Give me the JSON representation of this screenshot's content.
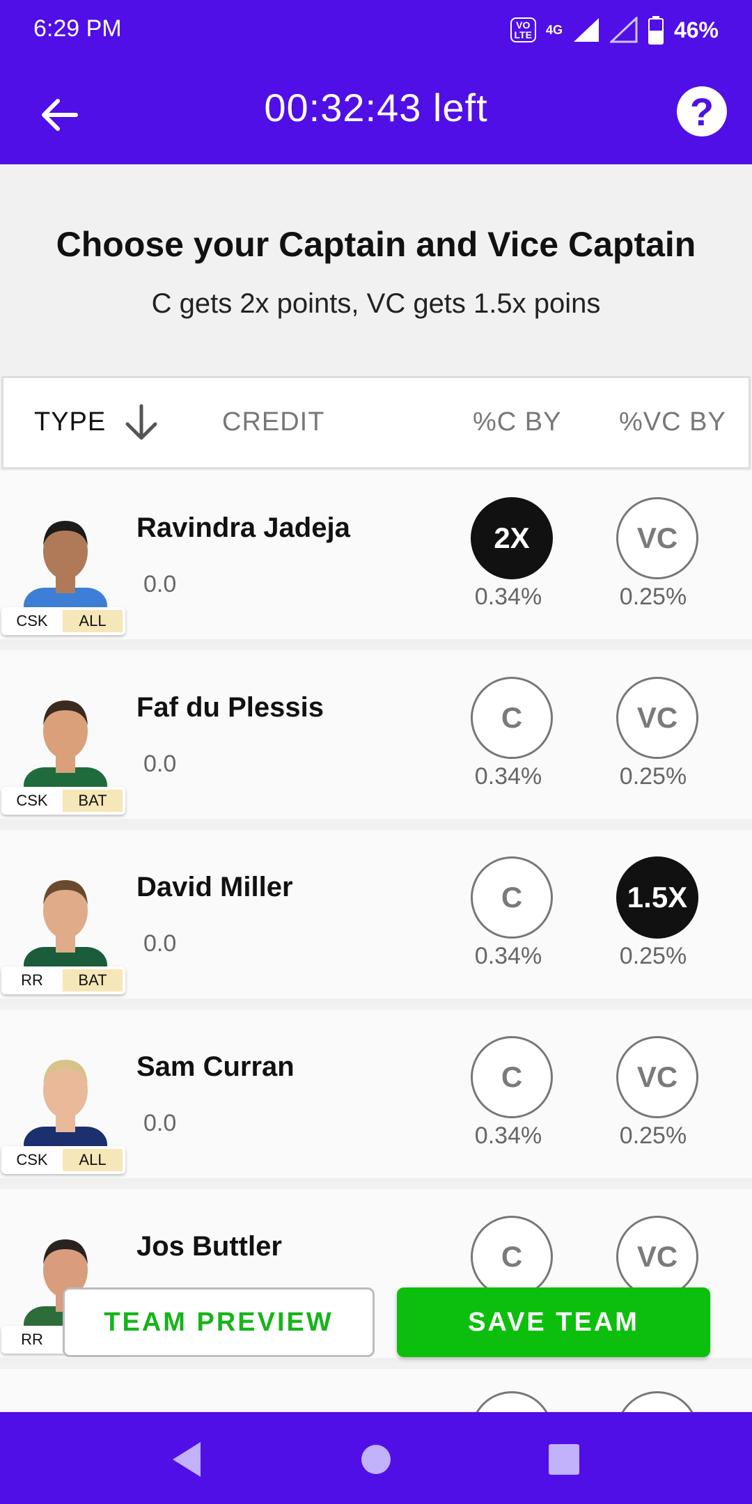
{
  "status_bar": {
    "time": "6:29 PM",
    "volte": "VoLTE",
    "network": "4G",
    "battery": "46%"
  },
  "toolbar": {
    "timer": "00:32:43 left",
    "help_label": "?"
  },
  "heading": {
    "title": "Choose your Captain and Vice Captain",
    "subtitle": "C gets 2x points, VC gets 1.5x poins"
  },
  "table_header": {
    "type": "TYPE",
    "credit": "CREDIT",
    "c_by": "%C BY",
    "vc_by": "%VC BY"
  },
  "players": [
    {
      "name": "Ravindra Jadeja",
      "credit": "0.0",
      "team": "CSK",
      "role": "ALL",
      "c_label": "2X",
      "c_active": true,
      "vc_label": "VC",
      "vc_active": false,
      "c_pct": "0.34%",
      "vc_pct": "0.25%",
      "jersey": "#3d7fd6",
      "skin": "#b07a58",
      "hair": "#1c1a1a"
    },
    {
      "name": "Faf du Plessis",
      "credit": "0.0",
      "team": "CSK",
      "role": "BAT",
      "c_label": "C",
      "c_active": false,
      "vc_label": "VC",
      "vc_active": false,
      "c_pct": "0.34%",
      "vc_pct": "0.25%",
      "jersey": "#1f6b3c",
      "skin": "#d9a07a",
      "hair": "#3a2a20"
    },
    {
      "name": "David Miller",
      "credit": "0.0",
      "team": "RR",
      "role": "BAT",
      "c_label": "C",
      "c_active": false,
      "vc_label": "1.5X",
      "vc_active": true,
      "c_pct": "0.34%",
      "vc_pct": "0.25%",
      "jersey": "#1b5c3a",
      "skin": "#e0ab88",
      "hair": "#6a4a2e"
    },
    {
      "name": "Sam Curran",
      "credit": "0.0",
      "team": "CSK",
      "role": "ALL",
      "c_label": "C",
      "c_active": false,
      "vc_label": "VC",
      "vc_active": false,
      "c_pct": "0.34%",
      "vc_pct": "0.25%",
      "jersey": "#1c2f6e",
      "skin": "#eab99a",
      "hair": "#d8c28a"
    },
    {
      "name": "Jos Buttler",
      "credit": "",
      "team": "RR",
      "role": "",
      "c_label": "C",
      "c_active": false,
      "vc_label": "VC",
      "vc_active": false,
      "c_pct": "",
      "vc_pct": "",
      "jersey": "#2c6d3a",
      "skin": "#d99c7c",
      "hair": "#2a2220"
    }
  ],
  "buttons": {
    "preview": "TEAM PREVIEW",
    "save": "SAVE TEAM"
  },
  "colors": {
    "brand": "#4f0fe6",
    "save": "#0cbf0c",
    "preview_text": "#16b41a"
  },
  "nav_bar": {
    "back": "back-icon",
    "home": "home-icon",
    "recents": "recents-icon"
  }
}
